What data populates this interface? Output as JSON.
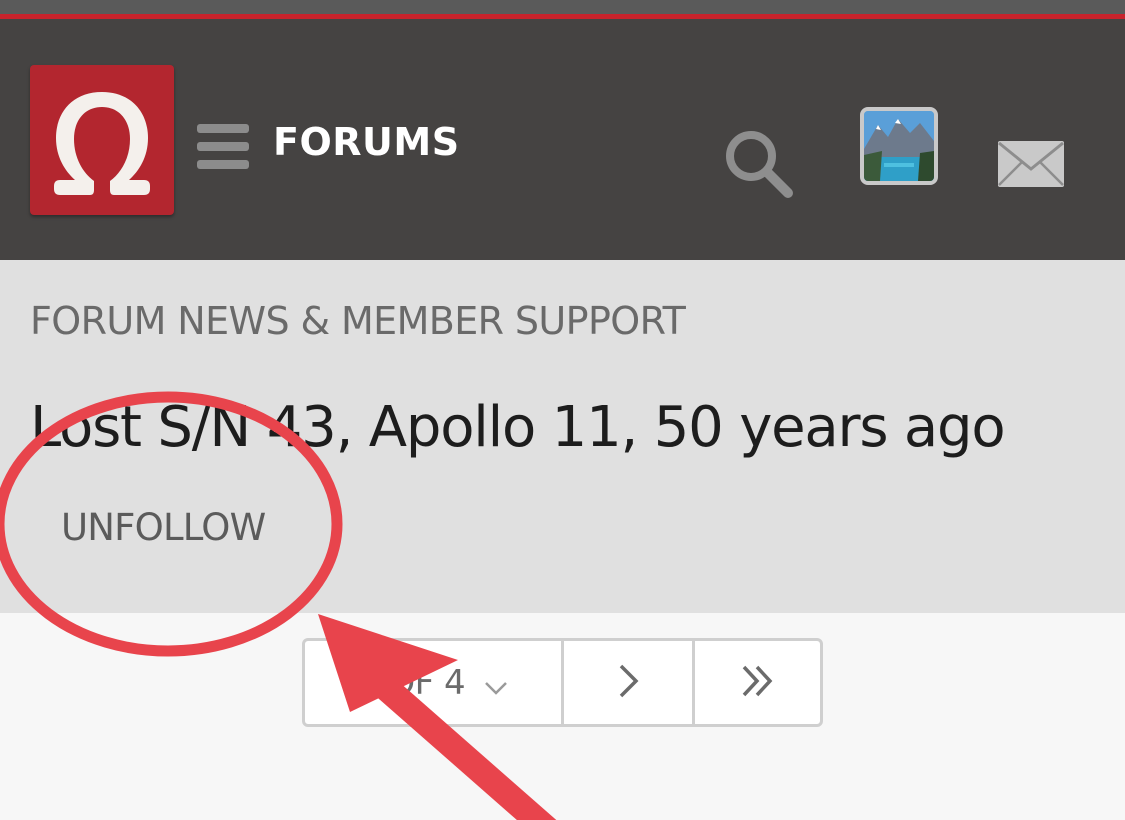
{
  "header": {
    "logo_icon": "omega-logo-icon",
    "menu_icon": "hamburger-menu-icon",
    "title": "FORUMS",
    "search_icon": "search-icon",
    "avatar": "user-avatar",
    "mail_icon": "mail-envelope-icon"
  },
  "thread": {
    "breadcrumb": "FORUM NEWS & MEMBER SUPPORT",
    "title": "Lost S/N 43, Apollo 11, 50 years ago",
    "unfollow_label": "UNFOLLOW"
  },
  "pagination": {
    "page_label": "1 OF 4",
    "next_icon": "chevron-right-icon",
    "last_icon": "double-chevron-right-icon"
  },
  "colors": {
    "header_bg": "#454342",
    "accent_red": "#c8232c",
    "logo_red": "#b3262f",
    "section_bg": "#e0e0e0",
    "annotation_red": "#e8444c"
  }
}
